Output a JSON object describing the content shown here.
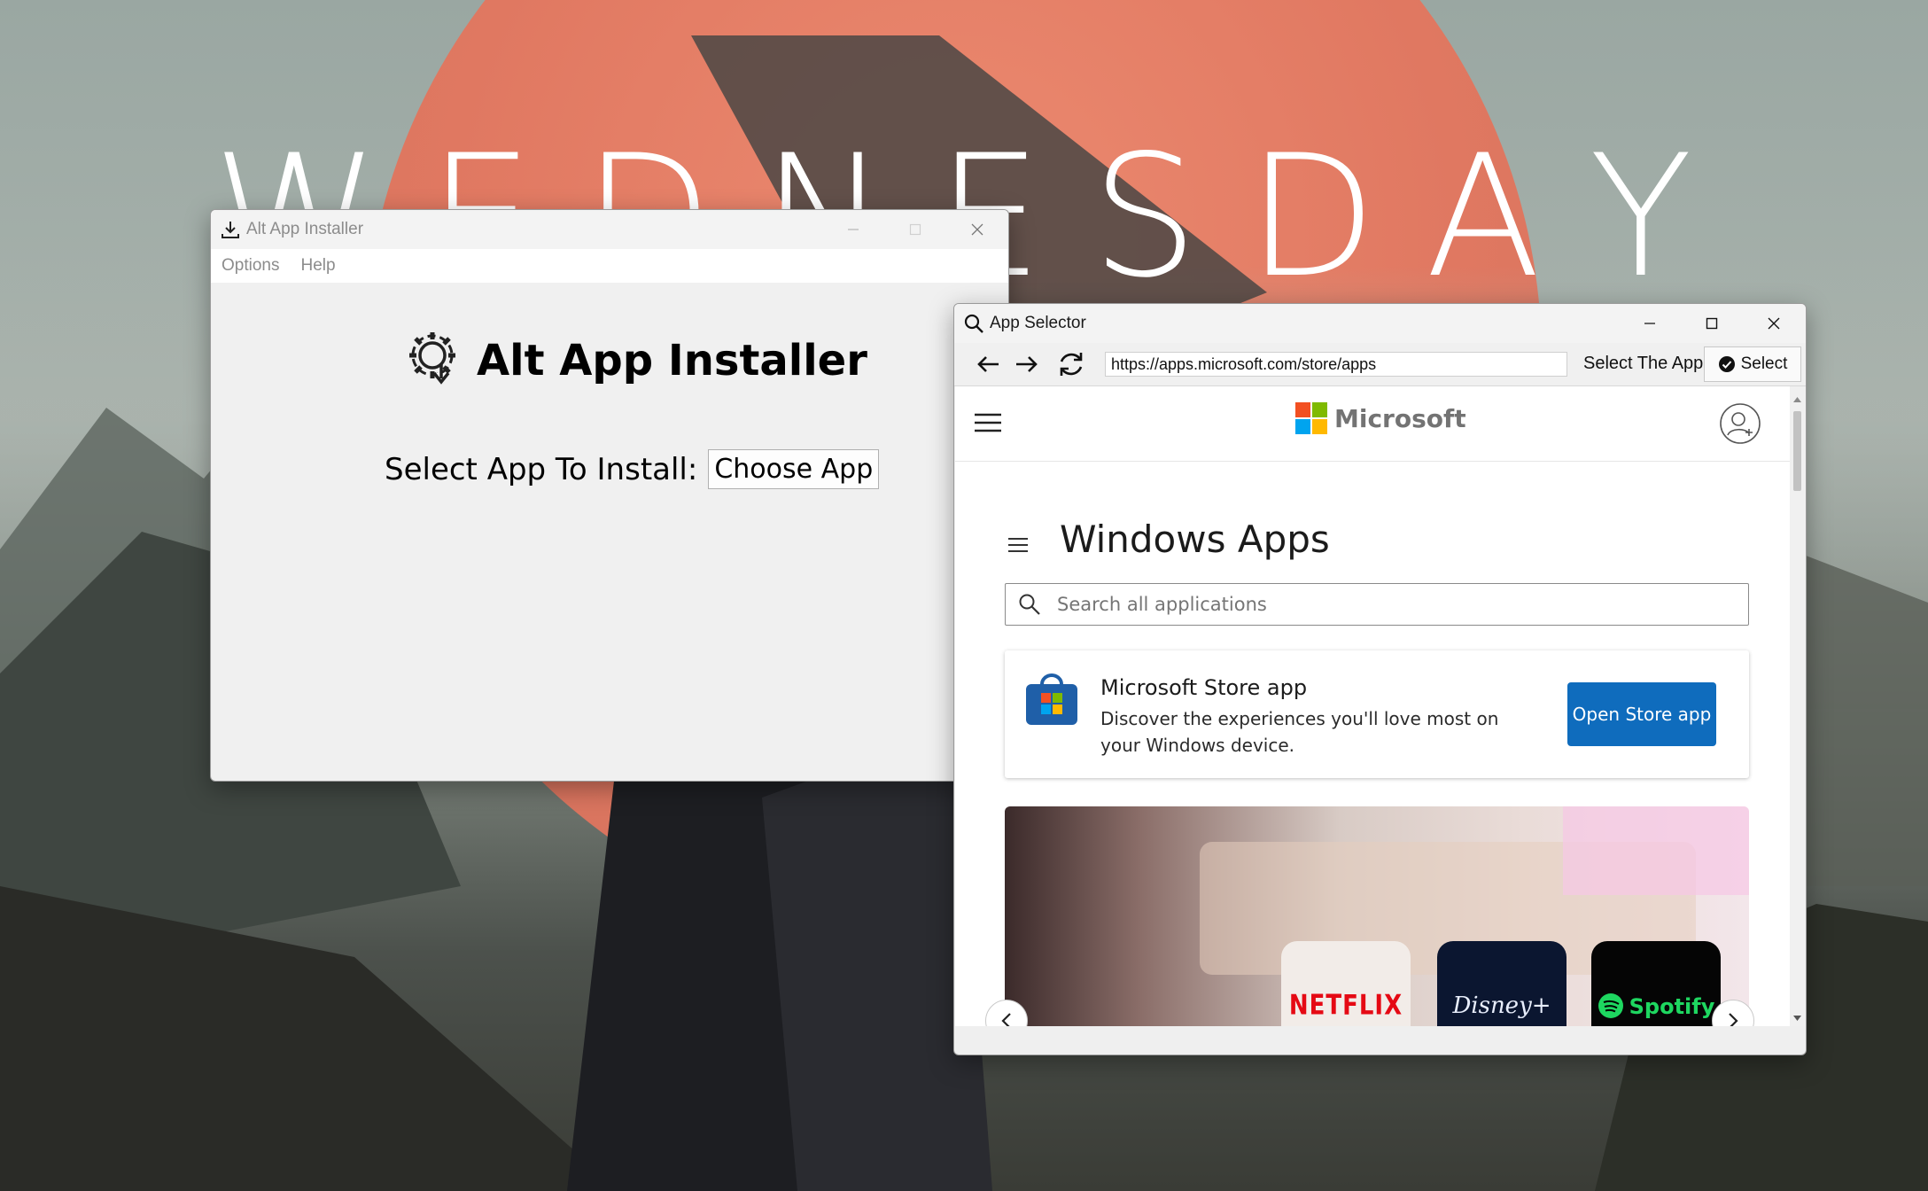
{
  "wallpaper": {
    "word_letters": [
      "W",
      "E",
      "D",
      "N",
      "E",
      "S",
      "D",
      "A",
      "Y"
    ]
  },
  "installer": {
    "title": "Alt App Installer",
    "menu": [
      "Options",
      "Help"
    ],
    "app_title": "Alt App Installer",
    "select_label": "Select App To Install:",
    "choose_button": "Choose App"
  },
  "selector": {
    "title": "App Selector",
    "url": "https://apps.microsoft.com/store/apps",
    "select_app_label": "Select The App",
    "select_button": "Select",
    "page": {
      "brand": "Microsoft",
      "heading": "Windows Apps",
      "search_placeholder": "Search all applications",
      "card": {
        "title": "Microsoft Store app",
        "description": "Discover the experiences you'll love most on your Windows device.",
        "button": "Open Store app"
      },
      "carousel_tiles": [
        "NETFLIX",
        "Disney+",
        "Spotify"
      ]
    }
  },
  "colors": {
    "accent": "#0f6cbd",
    "sun": "#e07861",
    "netflix": "#e50914",
    "spotify": "#1ed760"
  }
}
